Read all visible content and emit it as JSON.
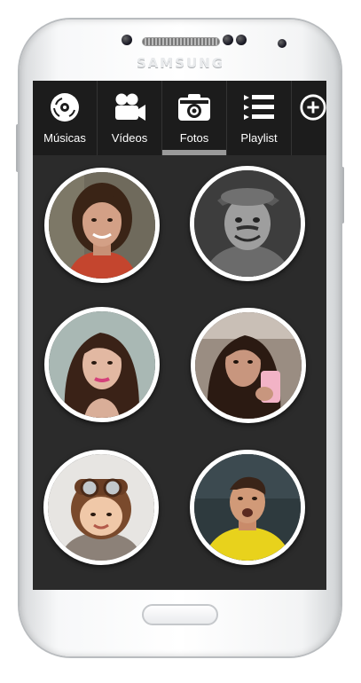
{
  "device": {
    "brand": "SAMSUNG"
  },
  "nav": {
    "tabs": [
      {
        "label": "Músicas",
        "icon": "disc-icon",
        "active": false
      },
      {
        "label": "Vídeos",
        "icon": "video-camera-icon",
        "active": false
      },
      {
        "label": "Fotos",
        "icon": "photo-camera-icon",
        "active": true
      },
      {
        "label": "Playlist",
        "icon": "playlist-icon",
        "active": false
      }
    ],
    "partial_icon": "add-circle-icon"
  },
  "colors": {
    "screen_bg": "#2b2b2b",
    "nav_bg": "#1c1c1c",
    "active_indicator": "#9a9a9a",
    "avatar_border": "#ffffff"
  },
  "photos": [
    {
      "id": "photo-1"
    },
    {
      "id": "photo-2"
    },
    {
      "id": "photo-3"
    },
    {
      "id": "photo-4"
    },
    {
      "id": "photo-5"
    },
    {
      "id": "photo-6"
    }
  ]
}
